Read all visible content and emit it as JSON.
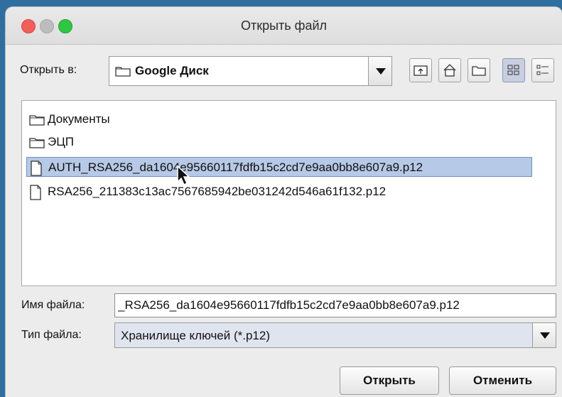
{
  "dialog": {
    "title": "Открыть файл"
  },
  "look_in": {
    "label": "Открыть в:",
    "value": "Google Диск"
  },
  "toolbar": {
    "buttons": [
      "up-folder-icon",
      "home-icon",
      "new-folder-icon",
      "list-view-icon",
      "details-view-icon"
    ]
  },
  "files": [
    {
      "name": "Документы",
      "type": "folder"
    },
    {
      "name": "ЭЦП",
      "type": "folder"
    },
    {
      "name": "AUTH_RSA256_da1604e95660117fdfb15c2cd7e9aa0bb8e607a9.p12",
      "type": "file",
      "selected": true
    },
    {
      "name": "RSA256_211383c13ac7567685942be031242d546a61f132.p12",
      "type": "file"
    }
  ],
  "file_name": {
    "label": "Имя файла:",
    "value": "_RSA256_da1604e95660117fdfb15c2cd7e9aa0bb8e607a9.p12"
  },
  "file_type": {
    "label": "Тип файла:",
    "value": "Хранилище ключей (*.p12)"
  },
  "buttons": {
    "open": "Открыть",
    "cancel": "Отменить"
  },
  "colors": {
    "selection": "#b6c9e6",
    "close": "#f25f57",
    "maximize": "#2ec642"
  }
}
